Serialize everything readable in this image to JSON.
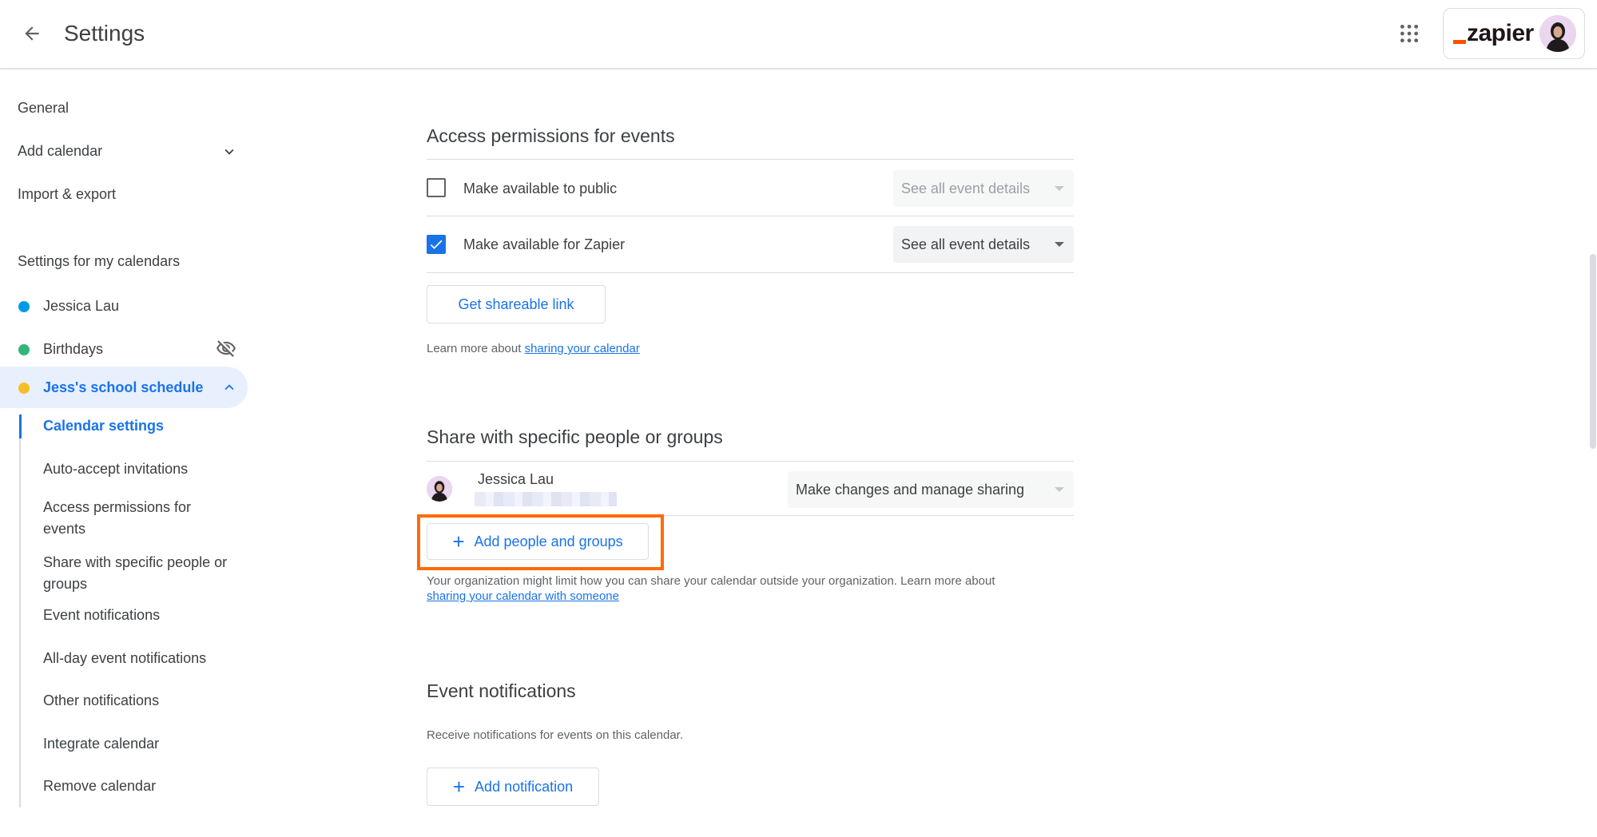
{
  "header": {
    "title": "Settings",
    "logo_text": "zapier"
  },
  "sidebar": {
    "top_items": [
      "General",
      "Add calendar",
      "Import & export"
    ],
    "heading": "Settings for my calendars",
    "calendars": [
      {
        "name": "Jessica Lau",
        "color": "#039be5"
      },
      {
        "name": "Birthdays",
        "color": "#33b679"
      },
      {
        "name": "Jess's school schedule",
        "color": "#f6bf26"
      }
    ],
    "sub_items": [
      "Calendar settings",
      "Auto-accept invitations",
      "Access permissions for events",
      "Share with specific people or groups",
      "Event notifications",
      "All-day event notifications",
      "Other notifications",
      "Integrate calendar",
      "Remove calendar"
    ]
  },
  "access": {
    "title": "Access permissions for events",
    "public_label": "Make available to public",
    "public_checked": false,
    "public_select": "See all event details",
    "org_label": "Make available for Zapier",
    "org_checked": true,
    "org_select": "See all event details",
    "shareable_button": "Get shareable link",
    "learn_prefix": "Learn more about ",
    "learn_link": "sharing your calendar"
  },
  "share": {
    "title": "Share with specific people or groups",
    "person_name": "Jessica Lau",
    "person_permission": "Make changes and manage sharing",
    "add_button": "Add people and groups",
    "note": "Your organization might limit how you can share your calendar outside your organization. Learn more about",
    "note_link": "sharing your calendar with someone"
  },
  "notifications": {
    "title": "Event notifications",
    "description": "Receive notifications for events on this calendar.",
    "add_button": "Add notification"
  },
  "colors": {
    "accent": "#1a73e8",
    "highlight": "#ff6b00"
  }
}
